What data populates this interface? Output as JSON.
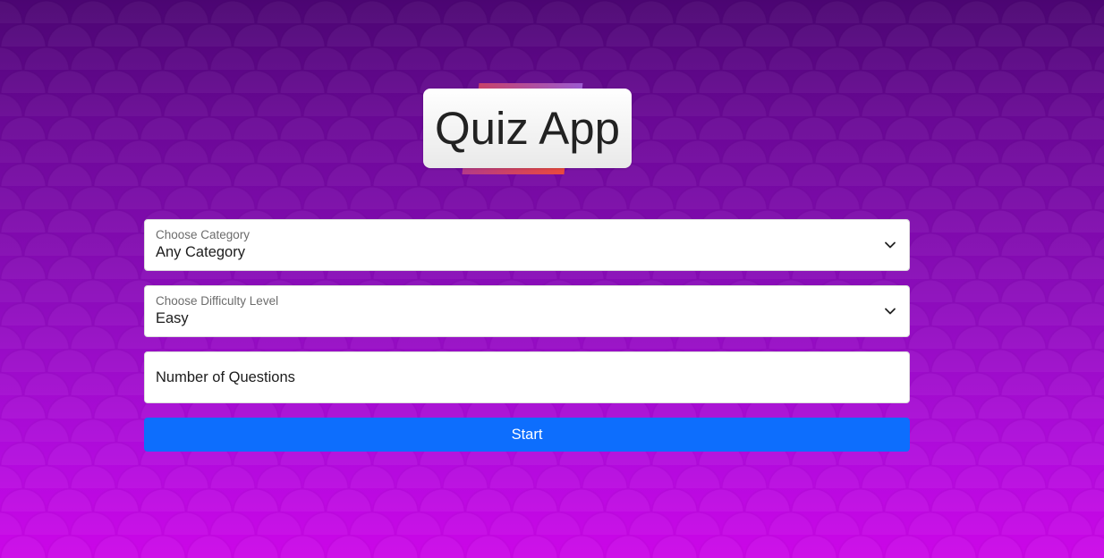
{
  "app": {
    "title": "Quiz App"
  },
  "form": {
    "category": {
      "label": "Choose Category",
      "value": "Any Category"
    },
    "difficulty": {
      "label": "Choose Difficulty Level",
      "value": "Easy"
    },
    "questions": {
      "placeholder": "Number of Questions",
      "value": ""
    },
    "start_label": "Start"
  },
  "colors": {
    "background_top": "#4b0572",
    "background_bottom": "#cc06e8",
    "button": "#0d6efd"
  },
  "icons": {
    "select_arrow": "chevron-down-icon"
  }
}
